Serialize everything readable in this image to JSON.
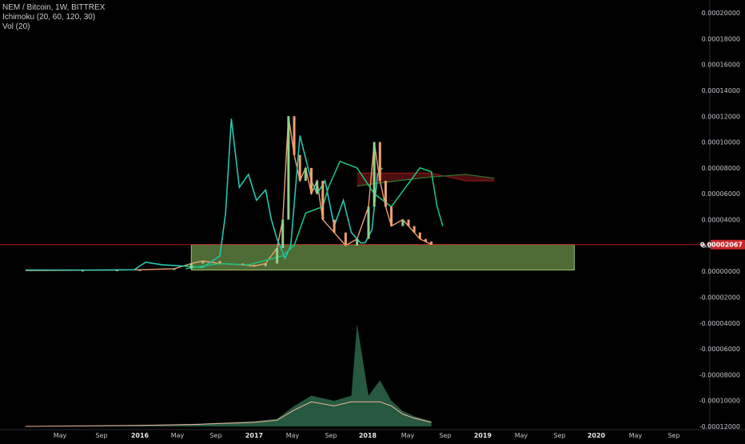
{
  "legend": {
    "symbol": "NEM / Bitcoin, 1W, BITTREX",
    "ichimoku": "Ichimoku (20, 60, 120, 30)",
    "volume": "Vol (20)"
  },
  "colors": {
    "background": "#000000",
    "price_up": "#8fd18a",
    "price_down": "#f0a070",
    "conversion_line": "#26c6b0",
    "cloud_green": "#2e7d32",
    "cloud_red": "#8b1a1a",
    "lagging_span": "#1fbf7a",
    "support_line": "#b71c1c",
    "zone_fill": "#6a8f48",
    "volume_green": "#2f6f4f",
    "volume_red": "#7f1f1f",
    "volume_ma": "#f2b6a0"
  },
  "chart_data": {
    "type": "line",
    "title": "NEM / Bitcoin, 1W, BITTREX",
    "x_ticks": [
      "May",
      "Sep",
      "2016",
      "May",
      "Sep",
      "2017",
      "May",
      "Sep",
      "2018",
      "May",
      "Sep",
      "2019",
      "May",
      "Sep",
      "2020",
      "May",
      "Sep"
    ],
    "bold_x_ticks": [
      "2016",
      "2017",
      "2018",
      "2019",
      "2020"
    ],
    "y_ticks": [
      "0.00020000",
      "0.00018000",
      "0.00016000",
      "0.00014000",
      "0.00012000",
      "0.00010000",
      "0.00008000",
      "0.00006000",
      "0.00004000",
      "0.00002000",
      "0.00000000",
      "-0.00002000",
      "-0.00004000",
      "-0.00006000",
      "-0.00008000",
      "-0.00010000",
      "-0.00012000"
    ],
    "ylim": [
      -0.00012,
      0.0002
    ],
    "current_price_label": "0.00002067",
    "current_price": 2.067e-05,
    "series": [
      {
        "name": "",
        "kind": "price_close",
        "x": [
          2015.0,
          2015.5,
          2015.8,
          2016.0,
          2016.3,
          2016.45,
          2016.55,
          2016.7,
          2016.9,
          2017.0,
          2017.1,
          2017.2,
          2017.25,
          2017.3,
          2017.35,
          2017.4,
          2017.45,
          2017.5,
          2017.55,
          2017.6,
          2017.7,
          2017.8,
          2017.9,
          2018.0,
          2018.05,
          2018.1,
          2018.15,
          2018.2,
          2018.3,
          2018.35,
          2018.4,
          2018.45,
          2018.5,
          2018.55
        ],
        "y": [
          6e-07,
          8e-07,
          1e-06,
          1.2e-06,
          2e-06,
          6e-06,
          8e-06,
          6e-06,
          5e-06,
          4e-06,
          6e-06,
          1.8e-05,
          4e-05,
          0.00012,
          9e-05,
          7e-05,
          8e-05,
          6e-05,
          7e-05,
          4e-05,
          3e-05,
          2e-05,
          2.5e-05,
          5e-05,
          0.0001,
          7e-05,
          5e-05,
          3.5e-05,
          4e-05,
          3.5e-05,
          3e-05,
          2.5e-05,
          2.3e-05,
          2.067e-05
        ]
      },
      {
        "name": "",
        "kind": "conversion_line",
        "x": [
          2015.0,
          2015.6,
          2015.95,
          2016.05,
          2016.2,
          2016.4,
          2016.55,
          2016.7,
          2016.75,
          2016.8,
          2016.87,
          2016.95,
          2017.02,
          2017.1,
          2017.15,
          2017.2,
          2017.27,
          2017.32,
          2017.4,
          2017.5,
          2017.55,
          2017.62,
          2017.7,
          2017.78,
          2017.85,
          2017.93,
          2017.97,
          2018.03,
          2018.08,
          2018.12
        ],
        "y": [
          1e-06,
          1e-06,
          1.2e-06,
          7e-06,
          5e-06,
          4e-06,
          3e-06,
          1.2e-05,
          4.5e-05,
          0.000118,
          6.5e-05,
          7.5e-05,
          5.5e-05,
          6.3e-05,
          4e-05,
          2.5e-05,
          1e-05,
          2e-05,
          0.000105,
          7e-05,
          6e-05,
          7e-05,
          3.5e-05,
          5.5e-05,
          3e-05,
          2.2e-05,
          2.2e-05,
          3.2e-05,
          7.5e-05,
          8e-05
        ]
      },
      {
        "name": "",
        "kind": "lagging_span",
        "x": [
          2016.4,
          2016.7,
          2016.95,
          2017.25,
          2017.35,
          2017.45,
          2017.6,
          2017.65,
          2017.75,
          2017.9,
          2018.05,
          2018.2,
          2018.35,
          2018.45,
          2018.55,
          2018.6,
          2018.65
        ],
        "y": [
          2e-06,
          6e-06,
          5e-06,
          1.2e-05,
          2e-05,
          4.5e-05,
          5e-05,
          6.5e-05,
          8.5e-05,
          8e-05,
          6e-05,
          5e-05,
          6.8e-05,
          8e-05,
          7.7e-05,
          5e-05,
          3.5e-05
        ]
      }
    ],
    "cloud": {
      "leading_a": {
        "x": [
          2017.9,
          2018.25,
          2018.55,
          2018.85,
          2019.1
        ],
        "y": [
          7.6e-05,
          7.6e-05,
          7.6e-05,
          7e-05,
          7e-05
        ]
      },
      "leading_b": {
        "x": [
          2017.9,
          2018.25,
          2018.55,
          2018.85,
          2019.1
        ],
        "y": [
          6.6e-05,
          7e-05,
          7.3e-05,
          7.5e-05,
          7.2e-05
        ]
      }
    },
    "zone": {
      "x_start": 2016.45,
      "x_end": 2019.8,
      "y_low": 1e-06,
      "y_high": 2.067e-05
    },
    "volume_chart_data": {
      "type": "area",
      "x": [
        2015.0,
        2016.0,
        2016.5,
        2017.0,
        2017.2,
        2017.35,
        2017.5,
        2017.7,
        2017.85,
        2017.9,
        2018.0,
        2018.1,
        2018.2,
        2018.3,
        2018.4,
        2018.55
      ],
      "values": [
        0.0,
        0.0005,
        0.001,
        0.002,
        0.003,
        0.008,
        0.012,
        0.01,
        0.012,
        0.04,
        0.012,
        0.018,
        0.01,
        0.006,
        0.004,
        0.002
      ]
    }
  }
}
